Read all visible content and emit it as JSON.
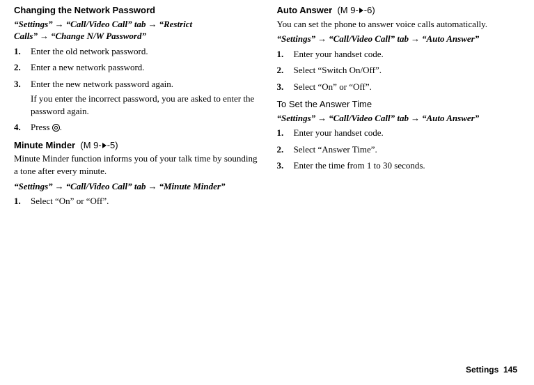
{
  "left": {
    "section1": {
      "heading": "Changing the Network Password",
      "path1": "“Settings”",
      "path2": "“Call/Video Call” tab",
      "path3": "“Restrict Calls”",
      "path4": "“Change N/W Password”",
      "steps": [
        "Enter the old network password.",
        "Enter a new network password.",
        "Enter the new network password again.",
        "Press"
      ],
      "step3_note": "If you enter the incorrect password, you are asked to enter the password again.",
      "press_suffix": "."
    },
    "section2": {
      "heading": "Minute Minder",
      "menu_ref_pre": " (M 9-",
      "menu_ref_post": "-5)",
      "intro": "Minute Minder function informs you of your talk time by sounding a tone after every minute.",
      "path1": "“Settings”",
      "path2": "“Call/Video Call” tab",
      "path3": "“Minute Minder”",
      "steps": [
        "Select “On” or “Off”."
      ]
    }
  },
  "right": {
    "section1": {
      "heading": "Auto Answer",
      "menu_ref_pre": " (M 9-",
      "menu_ref_post": "-6)",
      "intro": "You can set the phone to answer voice calls automatically.",
      "path1": "“Settings”",
      "path2": "“Call/Video Call” tab",
      "path3": "“Auto Answer”",
      "steps": [
        "Enter your handset code.",
        "Select “Switch On/Off”.",
        "Select “On” or “Off”."
      ]
    },
    "section2": {
      "sub_heading": "To Set the Answer Time",
      "path1": "“Settings”",
      "path2": "“Call/Video Call” tab",
      "path3": "“Auto Answer”",
      "steps": [
        "Enter your handset code.",
        "Select “Answer Time”.",
        "Enter the time from 1 to 30 seconds."
      ]
    }
  },
  "footer": {
    "label": "Settings",
    "page": "145"
  }
}
